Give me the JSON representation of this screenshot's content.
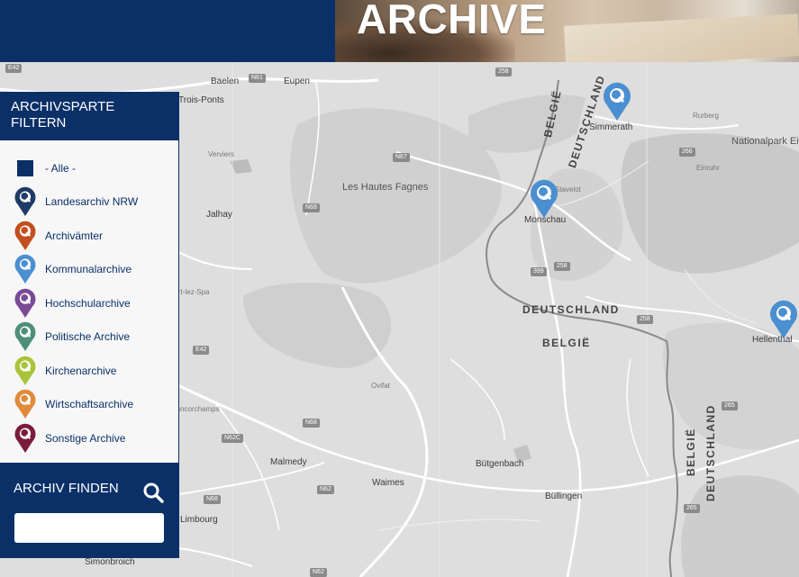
{
  "header": {
    "title": "ARCHIVE"
  },
  "filter": {
    "title": "ARCHIVSPARTE FILTERN",
    "items": [
      {
        "label": "- Alle -",
        "icon": "square-icon",
        "color": "#0b3068"
      },
      {
        "label": "Landesarchiv NRW",
        "icon": "map-pin-icon",
        "color": "#1f3a66"
      },
      {
        "label": "Archivämter",
        "icon": "map-pin-icon",
        "color": "#c24f1d"
      },
      {
        "label": "Kommunalarchive",
        "icon": "map-pin-icon",
        "color": "#4a8fd0"
      },
      {
        "label": "Hochschularchive",
        "icon": "map-pin-icon",
        "color": "#7b4a96"
      },
      {
        "label": "Politische Archive",
        "icon": "map-pin-icon",
        "color": "#4d8f7a"
      },
      {
        "label": "Kirchenarchive",
        "icon": "map-pin-icon",
        "color": "#a9c43a"
      },
      {
        "label": "Wirtschaftsarchive",
        "icon": "map-pin-icon",
        "color": "#e08a3a"
      },
      {
        "label": "Sonstige Archive",
        "icon": "map-pin-icon",
        "color": "#7a1d3a"
      }
    ]
  },
  "finder": {
    "title": "ARCHIV FINDEN",
    "search_icon": "search-icon",
    "input_value": "",
    "input_placeholder": ""
  },
  "map": {
    "pin_color": "#4a8fd0",
    "towns": [
      "Baelen",
      "Eupen",
      "Simmerath",
      "Rurberg",
      "Nationalpark Eifel",
      "Einruhr",
      "Les Hautes Fagnes",
      "Verviers",
      "Jalhay",
      "Monschau",
      "Hellenthal",
      "Malmedy",
      "Waimes",
      "Bütgenbach",
      "Büllingen",
      "Ovifat",
      "Francorchamps",
      "Trois-Ponts",
      "Stavelot",
      "Simonbroich",
      "Limbourg",
      "Sart-lez-Spa"
    ],
    "country_labels": [
      "BELGIË",
      "DEUTSCHLAND"
    ],
    "roads": [
      "E42",
      "N61",
      "N67",
      "N68",
      "N62",
      "N62C",
      "258",
      "266",
      "399",
      "265"
    ]
  }
}
